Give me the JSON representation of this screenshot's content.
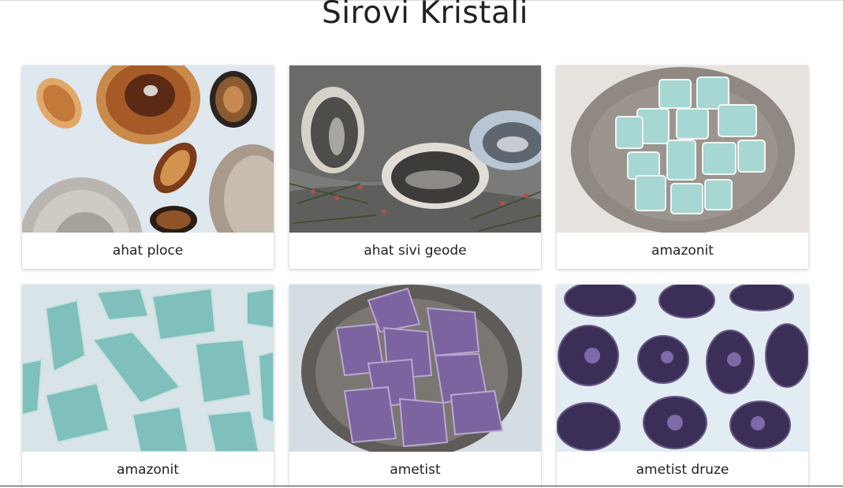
{
  "page": {
    "title": "Sirovi Kristali"
  },
  "products": [
    {
      "name": "ahat ploce",
      "image": "agate-slices-photo"
    },
    {
      "name": "ahat sivi geode",
      "image": "grey-agate-geodes-photo"
    },
    {
      "name": "amazonit",
      "image": "amazonite-in-bowl-photo"
    },
    {
      "name": "amazonit",
      "image": "raw-amazonite-photo"
    },
    {
      "name": "ametist",
      "image": "amethyst-in-bowl-photo"
    },
    {
      "name": "ametist druze",
      "image": "amethyst-druzy-photo"
    }
  ],
  "colors": {
    "title": "#222222",
    "caption": "#222222",
    "card_bg": "#ffffff"
  }
}
